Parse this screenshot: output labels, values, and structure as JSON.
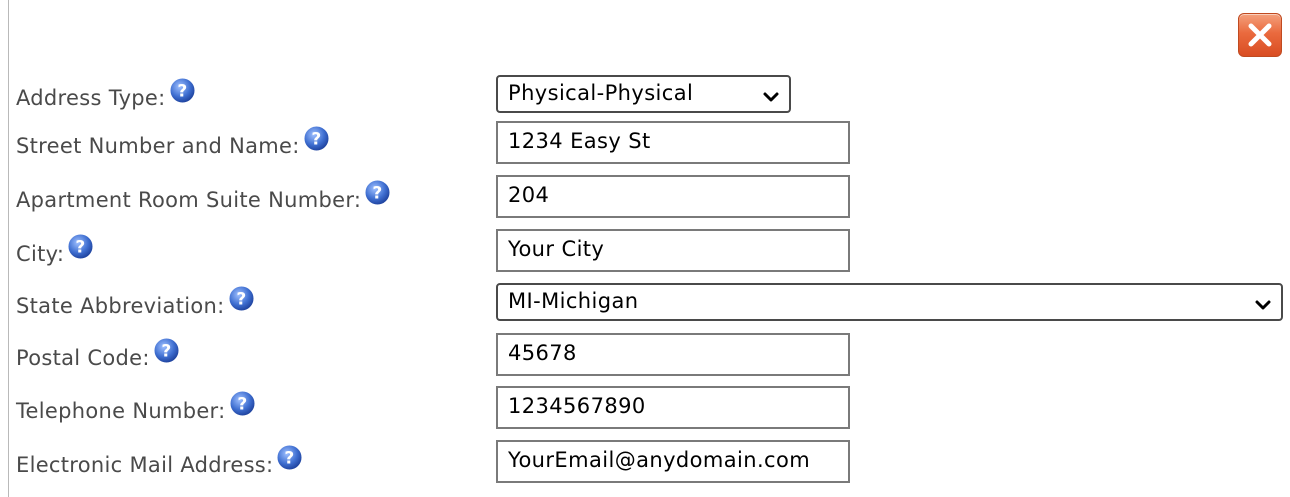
{
  "close": {
    "icon": "close-icon",
    "color": "#ea6a3e"
  },
  "help_icon": {
    "name": "help-icon",
    "color": "#3f6fd1"
  },
  "form": {
    "address_type": {
      "label": "Address Type:",
      "value": "Physical-Physical"
    },
    "street": {
      "label": "Street Number and Name:",
      "value": "1234 Easy St"
    },
    "apartment": {
      "label": "Apartment Room Suite Number:",
      "value": "204"
    },
    "city": {
      "label": "City:",
      "value": "Your City"
    },
    "state": {
      "label": "State Abbreviation:",
      "value": "MI-Michigan"
    },
    "postal": {
      "label": "Postal Code:",
      "value": "45678"
    },
    "telephone": {
      "label": "Telephone Number:",
      "value": "1234567890"
    },
    "email": {
      "label": "Electronic Mail Address:",
      "value": "YourEmail@anydomain.com"
    }
  }
}
